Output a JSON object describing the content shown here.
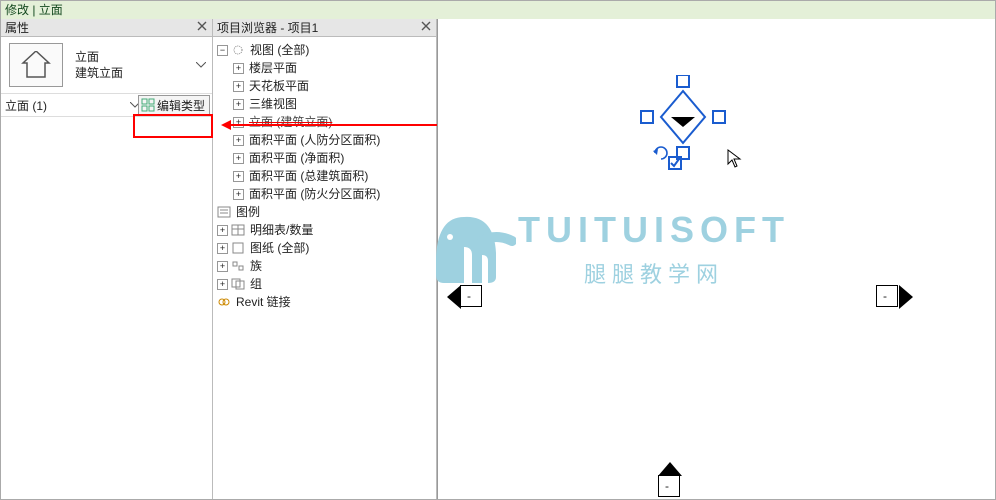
{
  "menubar": {
    "title": "修改 | 立面"
  },
  "props_panel": {
    "title": "属性",
    "type_name": "立面",
    "type_family": "建筑立面",
    "instance_label": "立面 (1)",
    "edit_type_label": "编辑类型"
  },
  "browser_panel": {
    "title": "项目浏览器 - 项目1",
    "root": {
      "label": "视图 (全部)",
      "children": [
        {
          "label": "楼层平面"
        },
        {
          "label": "天花板平面"
        },
        {
          "label": "三维视图"
        },
        {
          "label": "立面 (建筑立面)",
          "struck": true
        },
        {
          "label": "面积平面 (人防分区面积)"
        },
        {
          "label": "面积平面 (净面积)"
        },
        {
          "label": "面积平面 (总建筑面积)"
        },
        {
          "label": "面积平面 (防火分区面积)"
        }
      ]
    },
    "siblings": [
      {
        "label": "图例",
        "icon": "legend"
      },
      {
        "label": "明细表/数量",
        "icon": "schedule"
      },
      {
        "label": "图纸 (全部)",
        "icon": "sheet"
      },
      {
        "label": "族",
        "icon": "family"
      },
      {
        "label": "组",
        "icon": "group"
      },
      {
        "label": "Revit 链接",
        "icon": "link"
      }
    ]
  },
  "watermark": {
    "top": "TUITUISOFT",
    "sub": "腿腿教学网"
  },
  "markers": {
    "dash": "-"
  }
}
